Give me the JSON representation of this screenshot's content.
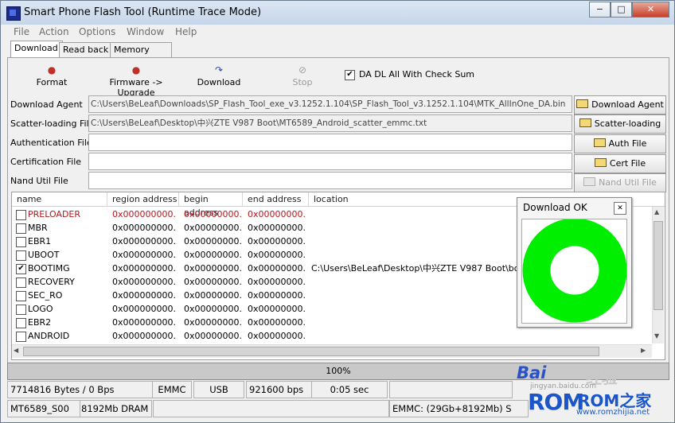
{
  "window": {
    "title": "Smart Phone Flash Tool (Runtime Trace Mode)",
    "buttons": {
      "minimize": "−",
      "maximize": "□",
      "close": "✕"
    }
  },
  "menu": [
    "File",
    "Action",
    "Options",
    "Window",
    "Help"
  ],
  "tabs": [
    "Download",
    "Read back",
    "Memory Test"
  ],
  "toolbar": {
    "format": "Format",
    "firmware_upgrade": "Firmware -> Upgrade",
    "download": "Download",
    "stop": "Stop",
    "checksum_label": "DA DL All With Check Sum",
    "checksum_checked": true
  },
  "fields": [
    {
      "label": "Download Agent",
      "value": "C:\\Users\\BeLeaf\\Downloads\\SP_Flash_Tool_exe_v3.1252.1.104\\SP_Flash_Tool_v3.1252.1.104\\MTK_AllInOne_DA.bin",
      "button": "Download Agent"
    },
    {
      "label": "Scatter-loading File",
      "value": "C:\\Users\\BeLeaf\\Desktop\\中兴ZTE V987 Boot\\MT6589_Android_scatter_emmc.txt",
      "button": "Scatter-loading"
    },
    {
      "label": "Authentication File",
      "value": "",
      "button": "Auth File"
    },
    {
      "label": "Certification File",
      "value": "",
      "button": "Cert File"
    },
    {
      "label": "Nand Util File",
      "value": "",
      "button": "Nand Util File"
    }
  ],
  "table": {
    "headers": [
      "name",
      "region address",
      "begin address",
      "end address",
      "location"
    ],
    "rows": [
      {
        "name": "PRELOADER",
        "checked": false,
        "red": true,
        "region": "0x000000000...",
        "begin": "0x00000000...",
        "end": "0x00000000...",
        "location": ""
      },
      {
        "name": "MBR",
        "checked": false,
        "red": false,
        "region": "0x000000000...",
        "begin": "0x00000000...",
        "end": "0x00000000...",
        "location": ""
      },
      {
        "name": "EBR1",
        "checked": false,
        "red": false,
        "region": "0x000000000...",
        "begin": "0x00000000...",
        "end": "0x00000000...",
        "location": ""
      },
      {
        "name": "UBOOT",
        "checked": false,
        "red": false,
        "region": "0x000000000...",
        "begin": "0x00000000...",
        "end": "0x00000000...",
        "location": ""
      },
      {
        "name": "BOOTIMG",
        "checked": true,
        "red": false,
        "region": "0x000000000...",
        "begin": "0x00000000...",
        "end": "0x00000000...",
        "location": "C:\\Users\\BeLeaf\\Desktop\\中兴ZTE V987 Boot\\boot..."
      },
      {
        "name": "RECOVERY",
        "checked": false,
        "red": false,
        "region": "0x000000000...",
        "begin": "0x00000000...",
        "end": "0x00000000...",
        "location": ""
      },
      {
        "name": "SEC_RO",
        "checked": false,
        "red": false,
        "region": "0x000000000...",
        "begin": "0x00000000...",
        "end": "0x00000000...",
        "location": ""
      },
      {
        "name": "LOGO",
        "checked": false,
        "red": false,
        "region": "0x000000000...",
        "begin": "0x00000000...",
        "end": "0x00000000...",
        "location": ""
      },
      {
        "name": "EBR2",
        "checked": false,
        "red": false,
        "region": "0x000000000...",
        "begin": "0x00000000...",
        "end": "0x00000000...",
        "location": ""
      },
      {
        "name": "ANDROID",
        "checked": false,
        "red": false,
        "region": "0x000000000...",
        "begin": "0x00000000...",
        "end": "0x00000000...",
        "location": ""
      }
    ]
  },
  "progress": {
    "percent": "100%"
  },
  "status": {
    "bytes": "7714816 Bytes / 0 Bps",
    "storage": "EMMC",
    "port": "USB",
    "baud": "921600 bps",
    "time": "0:05 sec",
    "chip": "MT6589_S00",
    "dram": "8192Mb DRAM",
    "emmc_info": "EMMC: (29Gb+8192Mb) S"
  },
  "popup": {
    "title": "Download OK",
    "close": "✕",
    "ring_color": "#00ee00"
  },
  "watermark": {
    "baidu": "Bai",
    "jingyan": "经验",
    "site": "jingyan.baidu.com",
    "rom": "ROM",
    "rom_zhijia": "ROM之家",
    "url": "www.romzhijia.net"
  }
}
